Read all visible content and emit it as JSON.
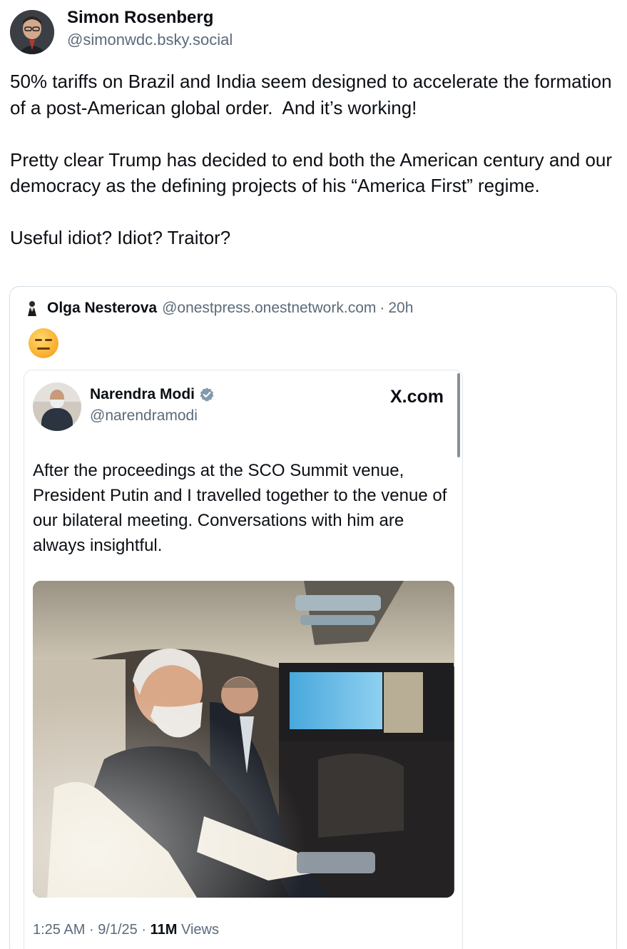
{
  "post": {
    "author_name": "Simon Rosenberg",
    "author_handle": "@simonwdc.bsky.social",
    "text": "50% tariffs on Brazil and India seem designed to accelerate the formation of a post-American global order.  And it’s working!\n\nPretty clear Trump has decided to end both the American century and our democracy as the defining projects of his “America First” regime.\n\nUseful idiot? Idiot? Traitor?"
  },
  "quote": {
    "author_name": "Olga Nesterova",
    "author_handle": "@onestpress.onestnetwork.com",
    "separator": "·",
    "time": "20h",
    "emoji": "expressionless-face"
  },
  "embedded_tweet": {
    "author_name": "Narendra Modi",
    "author_handle": "@narendramodi",
    "source": "X.com",
    "text": "After the proceedings at the SCO Summit venue, President Putin and I travelled together to the venue of our bilateral meeting. Conversations with him are always insightful.",
    "time": "1:25 AM",
    "date": "9/1/25",
    "separator": "·",
    "views_count": "11M",
    "views_label": "Views"
  },
  "colors": {
    "text": "#0b0f14",
    "muted": "#5b6b7a",
    "border": "#d6dde4",
    "verified": "#829aab"
  }
}
